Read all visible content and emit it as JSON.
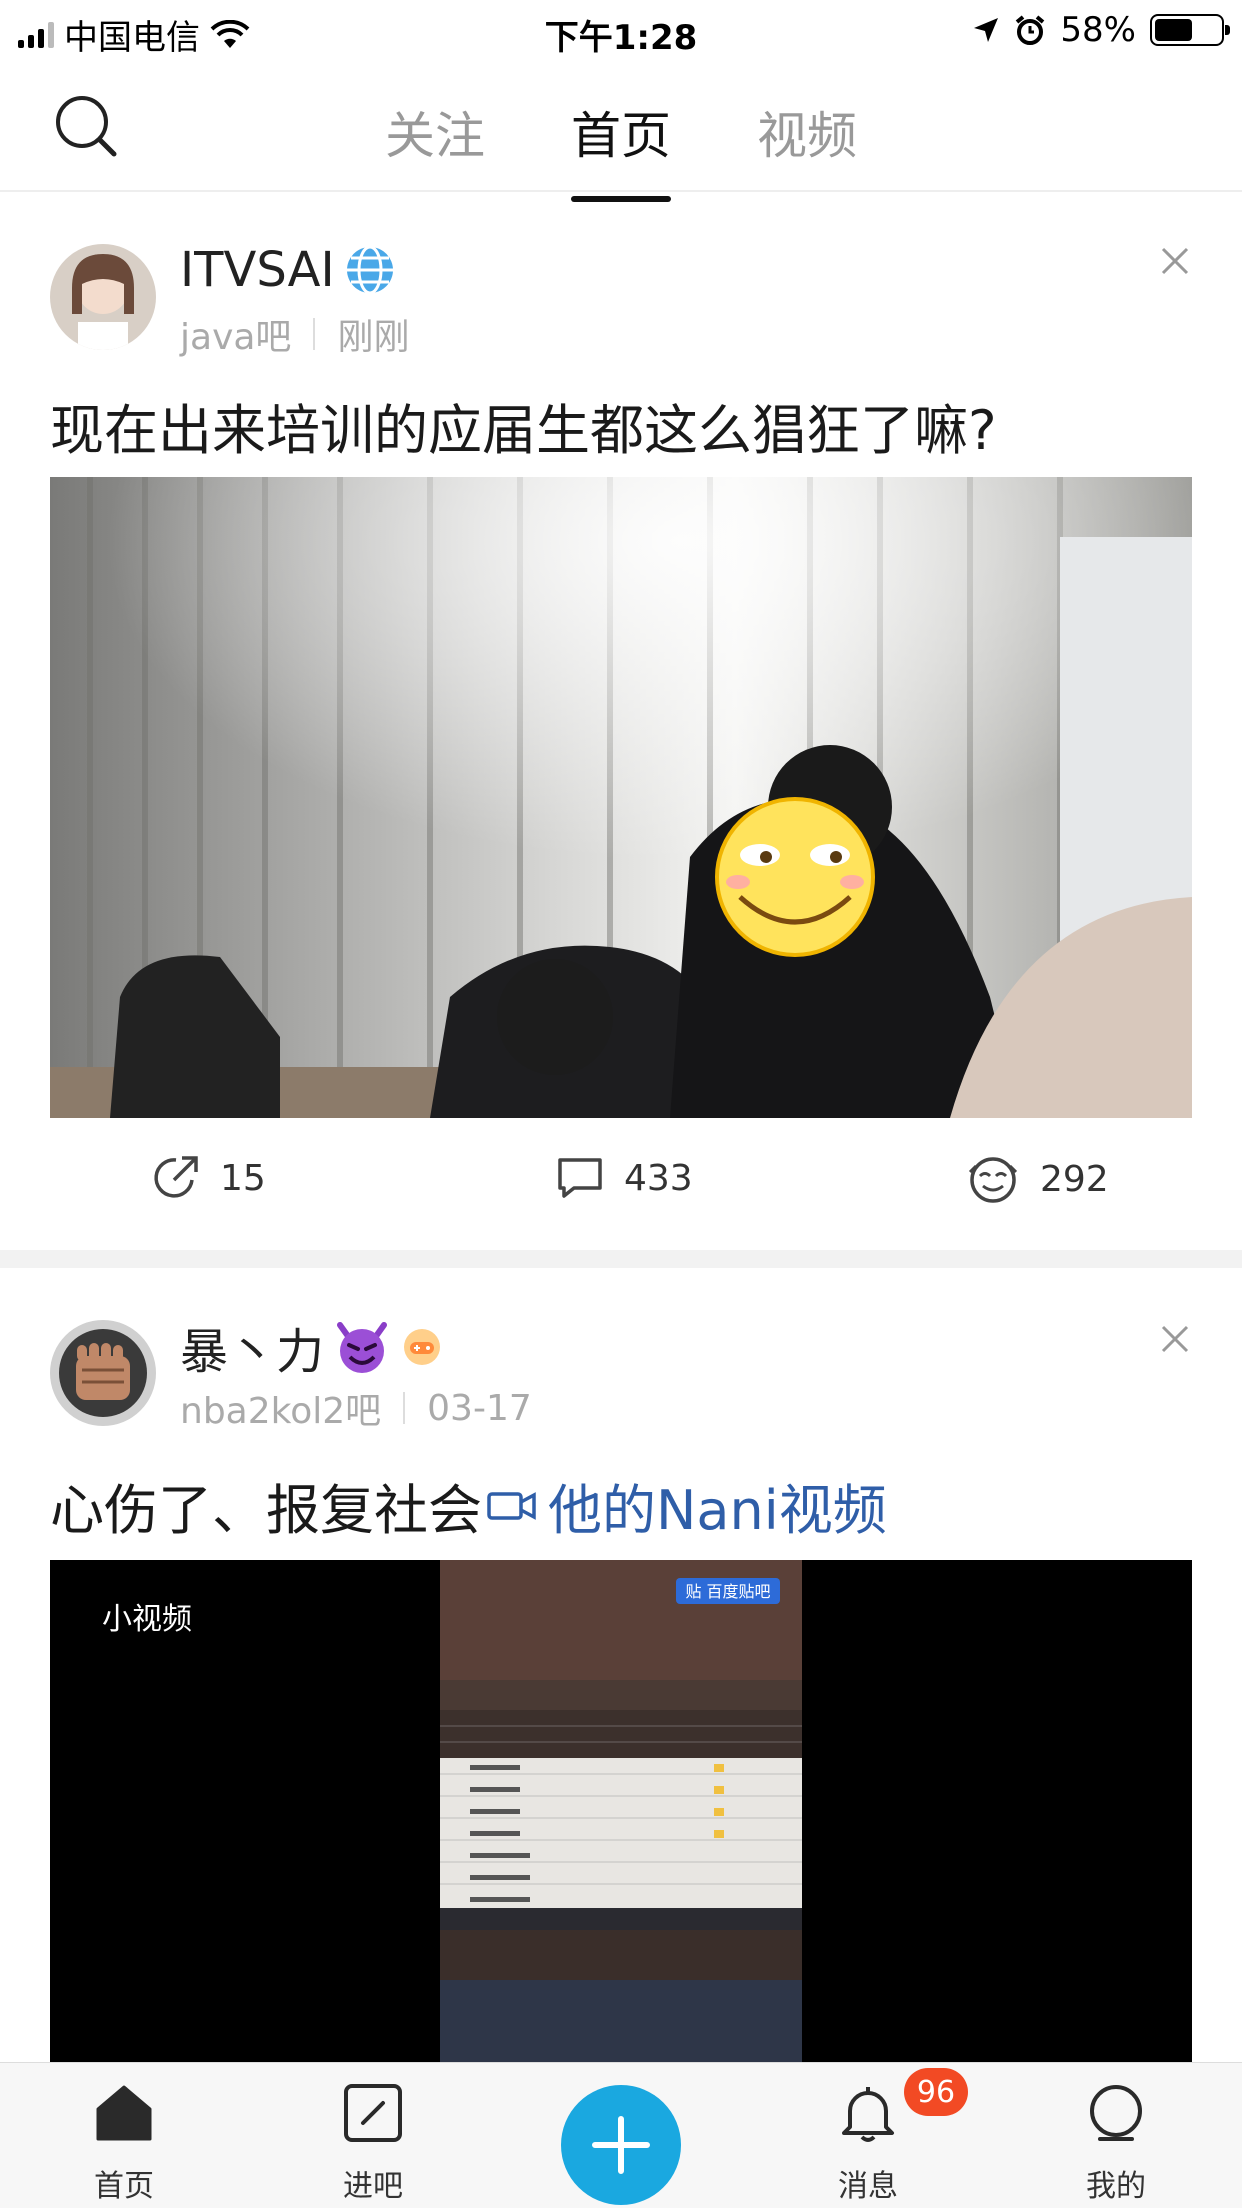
{
  "status_bar": {
    "carrier": "中国电信",
    "time": "下午1:28",
    "battery_percent": "58%"
  },
  "nav": {
    "tabs": [
      {
        "label": "关注",
        "active": false
      },
      {
        "label": "首页",
        "active": true
      },
      {
        "label": "视频",
        "active": false
      }
    ]
  },
  "posts": [
    {
      "username": "ITVSAI",
      "username_badge": "globe-emoji",
      "forum": "java吧",
      "time": "刚刚",
      "title": "现在出来培训的应届生都这么猖狂了嘛?",
      "media_type": "photo",
      "share_count": "15",
      "comment_count": "433",
      "like_count": "292"
    },
    {
      "username": "暴丶力",
      "username_badge": "devil-emoji",
      "forum": "nba2kol2吧",
      "time": "03-17",
      "title": "心伤了、报复社会",
      "video_link": "他的Nani视频",
      "media_type": "video",
      "video_label": "小视频",
      "watermark": "贴 百度贴吧"
    }
  ],
  "bottom_nav": {
    "items": [
      {
        "label": "首页",
        "icon": "home-icon"
      },
      {
        "label": "进吧",
        "icon": "enter-bar-icon"
      },
      {
        "label": "",
        "icon": "plus-icon"
      },
      {
        "label": "消息",
        "icon": "bell-icon"
      },
      {
        "label": "我的",
        "icon": "profile-icon"
      }
    ],
    "message_badge": "96"
  },
  "colors": {
    "accent_blue": "#1aa8e0",
    "badge_red": "#f24a24",
    "link_blue": "#2f5ea8"
  }
}
